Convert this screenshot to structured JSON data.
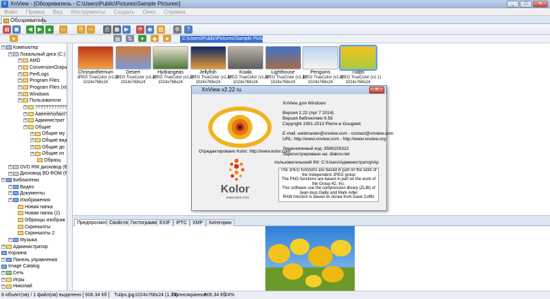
{
  "window": {
    "app_icon": "xnview-app-icon",
    "title": "XnView - [Обозреватель - C:\\Users\\Public\\Pictures\\Sample Pictures\\]"
  },
  "menu": [
    "Файл",
    "Правка",
    "Вид",
    "Инструменты",
    "Создать",
    "Окно",
    "Справка"
  ],
  "main_tab": "Обозреватель",
  "address": "C:\\Users\\Public\\Pictures\\Sample Pictures\\",
  "tree": [
    {
      "label": "Компьютер",
      "icon": "pc"
    },
    {
      "label": "Локальный диск (C:)",
      "icon": "drive"
    },
    {
      "label": "AMD",
      "icon": "folder"
    },
    {
      "label": "ConversionOutput",
      "icon": "folder"
    },
    {
      "label": "PerfLogs",
      "icon": "folder"
    },
    {
      "label": "Program Files",
      "icon": "folder"
    },
    {
      "label": "Program Files (x86",
      "icon": "folder"
    },
    {
      "label": "Windows",
      "icon": "folder"
    },
    {
      "label": "Пользователи",
      "icon": "folder"
    },
    {
      "label": "??????????????",
      "icon": "folder"
    },
    {
      "label": "Àäèèíèñòðàòî?",
      "icon": "folder"
    },
    {
      "label": "Администрат",
      "icon": "folder"
    },
    {
      "label": "Общие",
      "icon": "folder"
    },
    {
      "label": "Общие му",
      "icon": "folder"
    },
    {
      "label": "Общие вид",
      "icon": "folder"
    },
    {
      "label": "Общие до",
      "icon": "folder"
    },
    {
      "label": "Общие из",
      "icon": "folder"
    },
    {
      "label": "Образц",
      "icon": "folder"
    },
    {
      "label": "DVD RW дисковод (E",
      "icon": "drive"
    },
    {
      "label": "Дисковод BD-ROM (F",
      "icon": "drive"
    },
    {
      "label": "Библиотеки",
      "icon": "blue"
    },
    {
      "label": "Видео",
      "icon": "blue"
    },
    {
      "label": "Документы",
      "icon": "blue"
    },
    {
      "label": "Изображения",
      "icon": "blue"
    },
    {
      "label": "Новая папка",
      "icon": "folder"
    },
    {
      "label": "Новая папка (2)",
      "icon": "folder"
    },
    {
      "label": "Образцы изображ",
      "icon": "folder"
    },
    {
      "label": "Скриншоты",
      "icon": "folder"
    },
    {
      "label": "Скриншоты 2",
      "icon": "folder"
    },
    {
      "label": "Музыка",
      "icon": "blue"
    },
    {
      "label": "Администратор",
      "icon": "folder"
    },
    {
      "label": "Корзина",
      "icon": "blue"
    },
    {
      "label": "Панель управления",
      "icon": "blue"
    },
    {
      "label": "Image Catalog",
      "icon": "blue"
    },
    {
      "label": "Сеть",
      "icon": "green"
    },
    {
      "label": "Игры",
      "icon": "folder"
    },
    {
      "label": "Николай",
      "icon": "folder"
    }
  ],
  "thumbnails": [
    {
      "name": "Chrysanthemum",
      "format": "JPEG TrueColor (v1.1)",
      "size": "1024x768x24",
      "colors": [
        "#c2371a",
        "#f0a040"
      ]
    },
    {
      "name": "Desert",
      "format": "JPEG TrueColor (v1.1)",
      "size": "1024x768x24",
      "colors": [
        "#d27a3a",
        "#7a9ad8"
      ]
    },
    {
      "name": "Hydrangeas",
      "format": "JPEG TrueColor (v1.1)",
      "size": "1024x768x24",
      "colors": [
        "#e8e0d0",
        "#4f7a3a"
      ]
    },
    {
      "name": "Jellyfish",
      "format": "JPEG TrueColor (v1.1)",
      "size": "1024x768x24",
      "colors": [
        "#0c2a66",
        "#e79a38"
      ]
    },
    {
      "name": "Koala",
      "format": "JPEG TrueColor (v1.1)",
      "size": "1024x768x24",
      "colors": [
        "#b9b3a8",
        "#5e5e5a"
      ]
    },
    {
      "name": "Lighthouse",
      "format": "JPEG TrueColor (v1.1)",
      "size": "1024x768x24",
      "colors": [
        "#3f73c8",
        "#a66c4a"
      ]
    },
    {
      "name": "Penguins",
      "format": "JPEG TrueColor (v1.1)",
      "size": "1024x768x24",
      "colors": [
        "#b7d3ee",
        "#f4f4f4"
      ]
    },
    {
      "name": "Tulips",
      "format": "JPEG TrueColor (v1.1)",
      "size": "1024x768x24",
      "colors": [
        "#f2c21c",
        "#a9cc3e"
      ]
    }
  ],
  "about": {
    "title": "XnView v2.22 ru",
    "close": "✕",
    "product": "XnView для Windows",
    "version": "Версия 2.22 (Apr  7 2014)",
    "library": "Версия библиотеки 6.56",
    "copyright": "Copyright 1991-2013 Pierre-e Gougelet",
    "email": "E-mail: webmaster@xnview.com - contact@xnview.com",
    "url": "URL: http://www.xnview.com - http://www.xnview.org",
    "license_code": "Лицензионный код:    3588159322",
    "registered": "Зарегистрировано на:   diakov.net",
    "user_ini": "пользовательский INI: C:\\Users\\Администратор\\Ap",
    "edited": "Отредактировано Kolor. http://www.kolor.com",
    "kolor_name": "Kolor",
    "kolor_url": "www.kolor.com",
    "credits": [
      "The JPEG functions are based in part on the work of",
      "the Independent JPEG group",
      "The PNG functions are based in part on the work of",
      "the Group 42, Inc.",
      "This software use the compression library (ZLIB) of",
      "Jean-loup Gailly and Mark Adler",
      "RAW function is based on dcraw from Dave Coffin"
    ]
  },
  "preview_tabs": [
    "Предпросмотр",
    "Свойства",
    "Гистограмма",
    "EXIF",
    "IPTC",
    "XMP",
    "Категории"
  ],
  "status": {
    "count": "8 объект(ов) / 1 файл(ов) выделено  [ 606.34 Кб ]",
    "filename": "Tulips.jpg",
    "dims": "1024x768x24 (1.33)",
    "mode": "Полноэкранное",
    "size": "606.34 Кб",
    "zoom": "24%"
  }
}
